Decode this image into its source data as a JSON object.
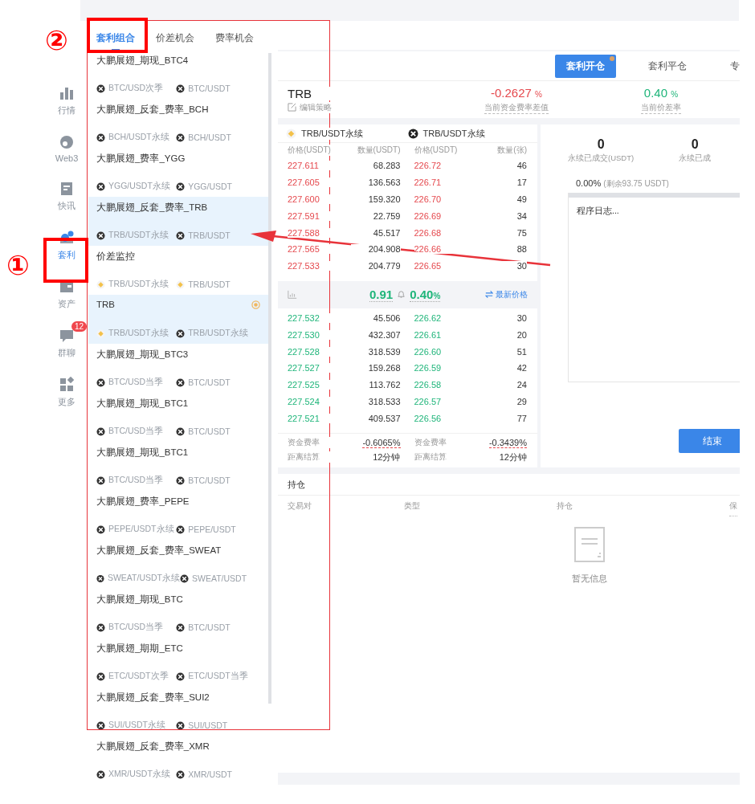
{
  "nav": [
    {
      "label": "行情",
      "selected": false
    },
    {
      "label": "Web3",
      "selected": false
    },
    {
      "label": "快讯",
      "selected": false
    },
    {
      "label": "套利",
      "selected": true
    },
    {
      "label": "资产",
      "selected": false
    },
    {
      "label": "群聊",
      "selected": false,
      "badge": "12"
    },
    {
      "label": "更多",
      "selected": false
    }
  ],
  "tabs": [
    {
      "label": "套利组合",
      "selected": true
    },
    {
      "label": "价差机会",
      "selected": false
    },
    {
      "label": "费率机会",
      "selected": false
    }
  ],
  "strategies": [
    {
      "title": "大鹏展翅_期现_BTC4",
      "selected": false,
      "running": false,
      "pairs": [
        {
          "label": "BTC/USD次季",
          "kind": "dark"
        },
        {
          "label": "BTC/USDT",
          "kind": "dark"
        }
      ]
    },
    {
      "title": "大鹏展翅_反套_费率_BCH",
      "selected": false,
      "running": false,
      "pairs": [
        {
          "label": "BCH/USDT永续",
          "kind": "dark"
        },
        {
          "label": "BCH/USDT",
          "kind": "dark"
        }
      ]
    },
    {
      "title": "大鹏展翅_费率_YGG",
      "selected": false,
      "running": false,
      "pairs": [
        {
          "label": "YGG/USDT永续",
          "kind": "dark"
        },
        {
          "label": "YGG/USDT",
          "kind": "dark"
        }
      ]
    },
    {
      "title": "大鹏展翅_反套_费率_TRB",
      "selected": true,
      "running": false,
      "pairs": [
        {
          "label": "TRB/USDT永续",
          "kind": "dark"
        },
        {
          "label": "TRB/USDT",
          "kind": "dark"
        }
      ]
    },
    {
      "title": "价差监控",
      "selected": false,
      "running": false,
      "pairs": [
        {
          "label": "TRB/USDT永续",
          "kind": "gold"
        },
        {
          "label": "TRB/USDT",
          "kind": "gold"
        }
      ]
    },
    {
      "title": "TRB",
      "selected": true,
      "running": true,
      "pairs": [
        {
          "label": "TRB/USDT永续",
          "kind": "gold"
        },
        {
          "label": "TRB/USDT永续",
          "kind": "dark"
        }
      ]
    },
    {
      "title": "大鹏展翅_期现_BTC3",
      "selected": false,
      "running": false,
      "pairs": [
        {
          "label": "BTC/USD当季",
          "kind": "dark"
        },
        {
          "label": "BTC/USDT",
          "kind": "dark"
        }
      ]
    },
    {
      "title": "大鹏展翅_期现_BTC1",
      "selected": false,
      "running": false,
      "pairs": [
        {
          "label": "BTC/USD当季",
          "kind": "dark"
        },
        {
          "label": "BTC/USDT",
          "kind": "dark"
        }
      ]
    },
    {
      "title": "大鹏展翅_期现_BTC1",
      "selected": false,
      "running": false,
      "pairs": [
        {
          "label": "BTC/USD当季",
          "kind": "dark"
        },
        {
          "label": "BTC/USDT",
          "kind": "dark"
        }
      ]
    },
    {
      "title": "大鹏展翅_费率_PEPE",
      "selected": false,
      "running": false,
      "pairs": [
        {
          "label": "PEPE/USDT永续",
          "kind": "dark"
        },
        {
          "label": "PEPE/USDT",
          "kind": "dark"
        }
      ]
    },
    {
      "title": "大鹏展翅_反套_费率_SWEAT",
      "selected": false,
      "running": false,
      "pairs": [
        {
          "label": "SWEAT/USDT永续",
          "kind": "dark"
        },
        {
          "label": "SWEAT/USDT",
          "kind": "dark"
        }
      ]
    },
    {
      "title": "大鹏展翅_期现_BTC",
      "selected": false,
      "running": false,
      "pairs": [
        {
          "label": "BTC/USD当季",
          "kind": "dark"
        },
        {
          "label": "BTC/USDT",
          "kind": "dark"
        }
      ]
    },
    {
      "title": "大鹏展翅_期期_ETC",
      "selected": false,
      "running": false,
      "pairs": [
        {
          "label": "ETC/USDT次季",
          "kind": "dark"
        },
        {
          "label": "ETC/USDT当季",
          "kind": "dark"
        }
      ]
    },
    {
      "title": "大鹏展翅_反套_费率_SUI2",
      "selected": false,
      "running": false,
      "pairs": [
        {
          "label": "SUI/USDT永续",
          "kind": "dark"
        },
        {
          "label": "SUI/USDT",
          "kind": "dark"
        }
      ]
    },
    {
      "title": "大鹏展翅_反套_费率_XMR",
      "selected": false,
      "running": false,
      "pairs": [
        {
          "label": "XMR/USDT永续",
          "kind": "dark"
        },
        {
          "label": "XMR/USDT",
          "kind": "dark"
        }
      ]
    }
  ],
  "action_tabs": [
    {
      "label": "套利开仓",
      "selected": true,
      "dot": true
    },
    {
      "label": "套利平仓",
      "selected": false,
      "dot": false
    },
    {
      "label": "专",
      "selected": false,
      "dot": false
    }
  ],
  "strategy": {
    "name": "TRB",
    "edit": "编辑策略",
    "stats": [
      {
        "value": "-0.2627",
        "unit": "%",
        "label": "当前资金费率差值",
        "kind": "down"
      },
      {
        "value": "0.40",
        "unit": "%",
        "label": "当前价差率",
        "kind": "up"
      }
    ]
  },
  "order_book": {
    "pairs": [
      {
        "label": "TRB/USDT永续",
        "kind": "gold"
      },
      {
        "label": "TRB/USDT永续",
        "kind": "dark"
      }
    ],
    "columns": [
      "价格(USDT)",
      "数量(USDT)",
      "价格(USDT)",
      "数量(张)"
    ],
    "asks": [
      [
        "227.611",
        "68.283",
        "226.72",
        "46"
      ],
      [
        "227.605",
        "136.563",
        "226.71",
        "17"
      ],
      [
        "227.600",
        "159.320",
        "226.70",
        "49"
      ],
      [
        "227.591",
        "22.759",
        "226.69",
        "34"
      ],
      [
        "227.588",
        "45.517",
        "226.68",
        "75"
      ],
      [
        "227.565",
        "204.908",
        "226.66",
        "88"
      ],
      [
        "227.533",
        "204.779",
        "226.65",
        "30"
      ]
    ],
    "spread": {
      "value": "0.91",
      "rate": "0.40",
      "unit": "%",
      "link": "最新价格"
    },
    "bids": [
      [
        "227.532",
        "45.506",
        "226.62",
        "30"
      ],
      [
        "227.530",
        "432.307",
        "226.61",
        "20"
      ],
      [
        "227.528",
        "318.539",
        "226.60",
        "51"
      ],
      [
        "227.527",
        "159.268",
        "226.59",
        "42"
      ],
      [
        "227.525",
        "113.762",
        "226.58",
        "24"
      ],
      [
        "227.524",
        "318.533",
        "226.57",
        "29"
      ],
      [
        "227.521",
        "409.537",
        "226.56",
        "77"
      ]
    ],
    "footer": [
      [
        "资金费率",
        "-0.6065%",
        "资金费率",
        "-0.3439%"
      ],
      [
        "距离结算",
        "12分钟",
        "距离结算",
        "12分钟"
      ]
    ]
  },
  "execution": {
    "counters": [
      {
        "value": "0",
        "label": "永续已成交(USDT)"
      },
      {
        "value": "0",
        "label": "永续已成"
      }
    ],
    "progress": {
      "level": 0,
      "text": "0.00%",
      "note": "(剩余93.75 USDT)"
    },
    "log_placeholder": "程序日志...",
    "button": "结束"
  },
  "positions": {
    "title": "持仓",
    "columns": [
      "交易对",
      "类型",
      "持仓",
      "保"
    ],
    "empty": "暂无信息"
  },
  "annotations": [
    {
      "text": "①"
    },
    {
      "text": "②"
    }
  ]
}
